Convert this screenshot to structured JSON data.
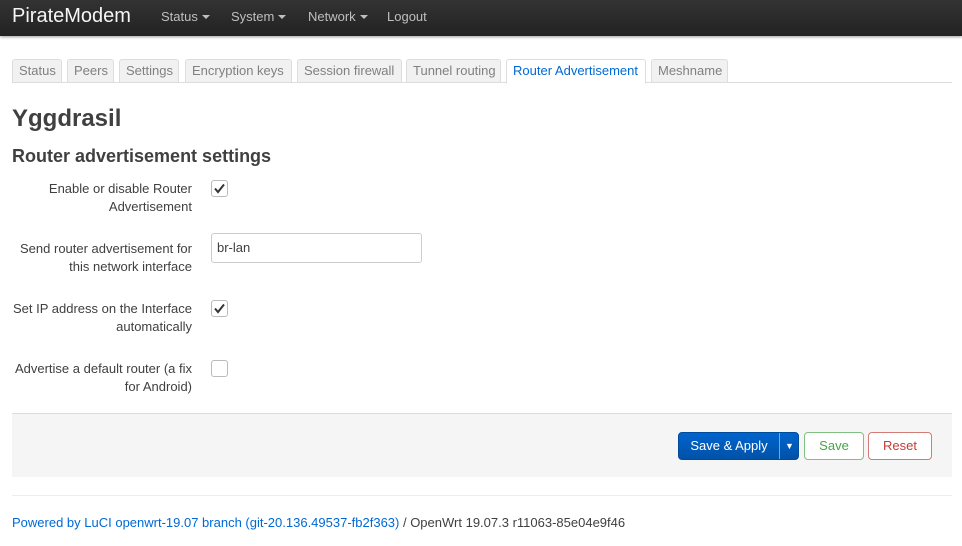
{
  "navbar": {
    "brand": "PirateModem",
    "items": [
      {
        "label": "Status"
      },
      {
        "label": "System"
      },
      {
        "label": "Network"
      },
      {
        "label": "Logout"
      }
    ]
  },
  "tabs": [
    {
      "label": "Status"
    },
    {
      "label": "Peers"
    },
    {
      "label": "Settings"
    },
    {
      "label": "Encryption keys"
    },
    {
      "label": "Session firewall"
    },
    {
      "label": "Tunnel routing"
    },
    {
      "label": "Router Advertisement",
      "active": true
    },
    {
      "label": "Meshname"
    }
  ],
  "page": {
    "title": "Yggdrasil",
    "section_title": "Router advertisement settings"
  },
  "form": {
    "enable_ra": {
      "label": "Enable or disable Router Advertisement",
      "checked": true
    },
    "interface": {
      "label": "Send router advertisement for this network interface",
      "value": "br-lan"
    },
    "auto_ip": {
      "label": "Set IP address on the Interface automatically",
      "checked": true
    },
    "default_router": {
      "label": "Advertise a default router (a fix for Android)",
      "checked": false
    }
  },
  "actions": {
    "save_apply": "Save & Apply",
    "save": "Save",
    "reset": "Reset"
  },
  "footer": {
    "link": "Powered by LuCI openwrt-19.07 branch (git-20.136.49537-fb2f363)",
    "version": " / OpenWrt 19.07.3 r11063-85e04e9f46"
  },
  "colors": {
    "accent": "#0069d6",
    "primary_button": "#0064cd",
    "save_green": "#46a546",
    "reset_red": "#c43c35",
    "navbar": "#222222"
  }
}
